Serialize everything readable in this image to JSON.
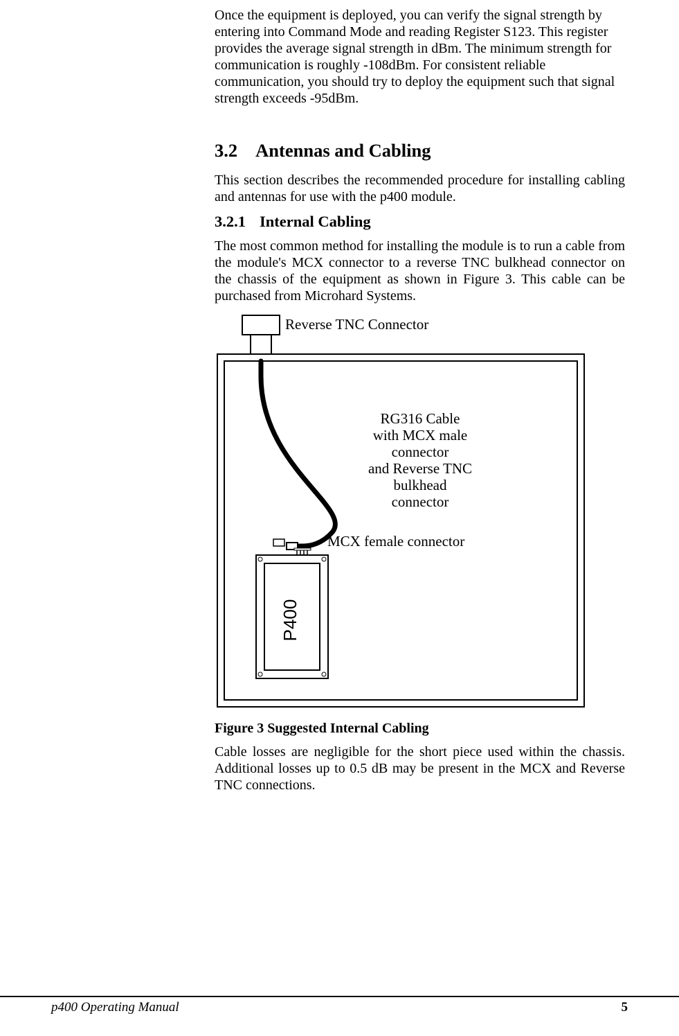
{
  "intro_para": "Once the equipment is deployed, you can verify the signal strength by entering into Command Mode and reading Register S123.  This register provides the average signal strength in dBm.  The minimum strength for communication is roughly -108dBm.  For consistent reliable communication, you should try to deploy the equipment such that signal strength exceeds -95dBm.",
  "section_3_2": {
    "number": "3.2",
    "title": "Antennas and Cabling",
    "intro": "This section describes the recommended procedure for installing cabling and antennas for use with the p400 module."
  },
  "section_3_2_1": {
    "number": "3.2.1",
    "title": "Internal Cabling",
    "para1": "The most common method for installing the module is to run a cable from the module's MCX connector to a reverse TNC bulkhead connector on the chassis of the equipment as shown in Figure 3.  This cable can be purchased from Microhard Systems.",
    "para2": "Cable losses are negligible for the short piece used within the chassis.  Additional losses up to 0.5 dB may be present in the MCX and Reverse TNC connections."
  },
  "figure": {
    "caption": "Figure 3 Suggested Internal Cabling",
    "labels": {
      "reverse_tnc": "Reverse TNC Connector",
      "cable_line1": "RG316 Cable",
      "cable_line2": "with MCX male",
      "cable_line3": "connector",
      "cable_line4": "and Reverse TNC",
      "cable_line5": "bulkhead",
      "cable_line6": "connector",
      "mcx_female": "MCX female connector",
      "module": "P400"
    }
  },
  "footer": {
    "doc_title": "p400 Operating Manual",
    "page": "5"
  }
}
